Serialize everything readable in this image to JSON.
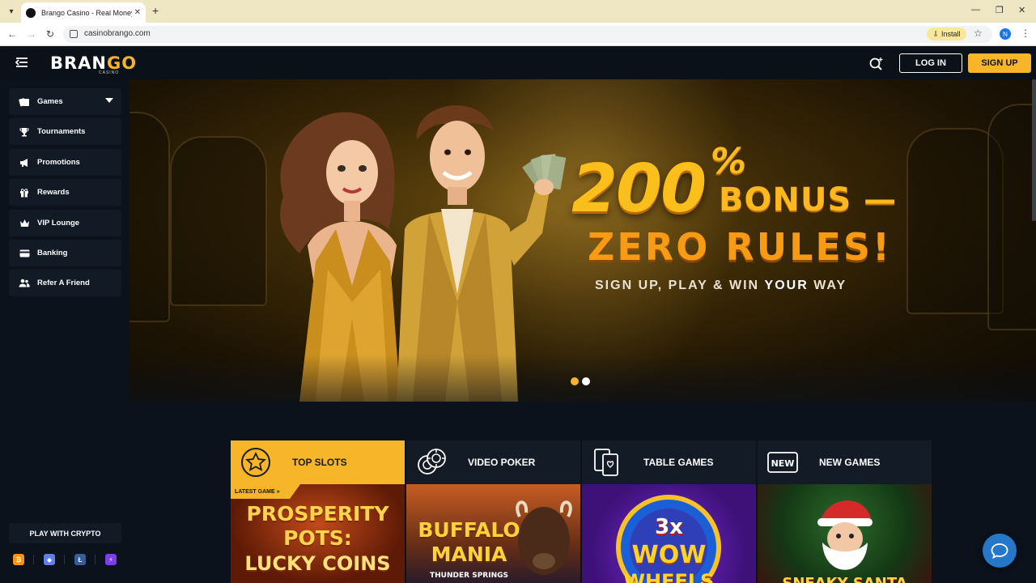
{
  "browser": {
    "tab_title": "Brango Casino - Real Money C",
    "url": "casinobrango.com",
    "install_label": "Install",
    "profile_initial": "N"
  },
  "header": {
    "logo_main": "BRAN",
    "logo_accent": "GO",
    "logo_sub": "CASINO",
    "login_label": "LOG IN",
    "signup_label": "SIGN UP"
  },
  "sidebar": {
    "items": [
      {
        "label": "Games",
        "icon": "cards-icon"
      },
      {
        "label": "Tournaments",
        "icon": "trophy-icon"
      },
      {
        "label": "Promotions",
        "icon": "megaphone-icon"
      },
      {
        "label": "Rewards",
        "icon": "gift-icon"
      },
      {
        "label": "VIP Lounge",
        "icon": "crown-icon"
      },
      {
        "label": "Banking",
        "icon": "wallet-icon"
      },
      {
        "label": "Refer A Friend",
        "icon": "users-icon"
      }
    ],
    "crypto_title": "PLAY WITH CRYPTO",
    "crypto": [
      {
        "name": "bitcoin-icon",
        "glyph": "₿",
        "color": "#f7931a"
      },
      {
        "name": "ethereum-icon",
        "glyph": "◆",
        "color": "#627eea"
      },
      {
        "name": "litecoin-icon",
        "glyph": "Ł",
        "color": "#345d9d"
      },
      {
        "name": "lightning-icon",
        "glyph": "⚡",
        "color": "#7b3fe4"
      }
    ]
  },
  "hero": {
    "bonus_number": "200",
    "bonus_percent": "%",
    "bonus_word": "BONUS —",
    "zero_rules": "ZERO RULES!",
    "sub_prefix": "SIGN UP, PLAY & WIN ",
    "sub_bold": "YOUR",
    "sub_suffix": " WAY",
    "slides": 2,
    "active_slide": 1
  },
  "categories": [
    {
      "label": "TOP SLOTS",
      "active": true
    },
    {
      "label": "VIDEO POKER",
      "active": false
    },
    {
      "label": "TABLE GAMES",
      "active": false
    },
    {
      "label": "NEW GAMES",
      "active": false
    }
  ],
  "games": [
    {
      "line1": "PROSPERITY",
      "line2": "POTS:",
      "line3": "LUCKY COINS",
      "badge": "LATEST GAME »"
    },
    {
      "line1": "BUFFALO",
      "line2": "MANIA",
      "line3": "THUNDER SPRINGS"
    },
    {
      "line1": "3x",
      "line2": "WOW",
      "line3": "WHEELS"
    },
    {
      "line1": "SNEAKY SANTA",
      "line2": "",
      "line3": ""
    }
  ],
  "colors": {
    "accent": "#f7b52a",
    "background": "#0b121c",
    "panel": "#111a25"
  }
}
